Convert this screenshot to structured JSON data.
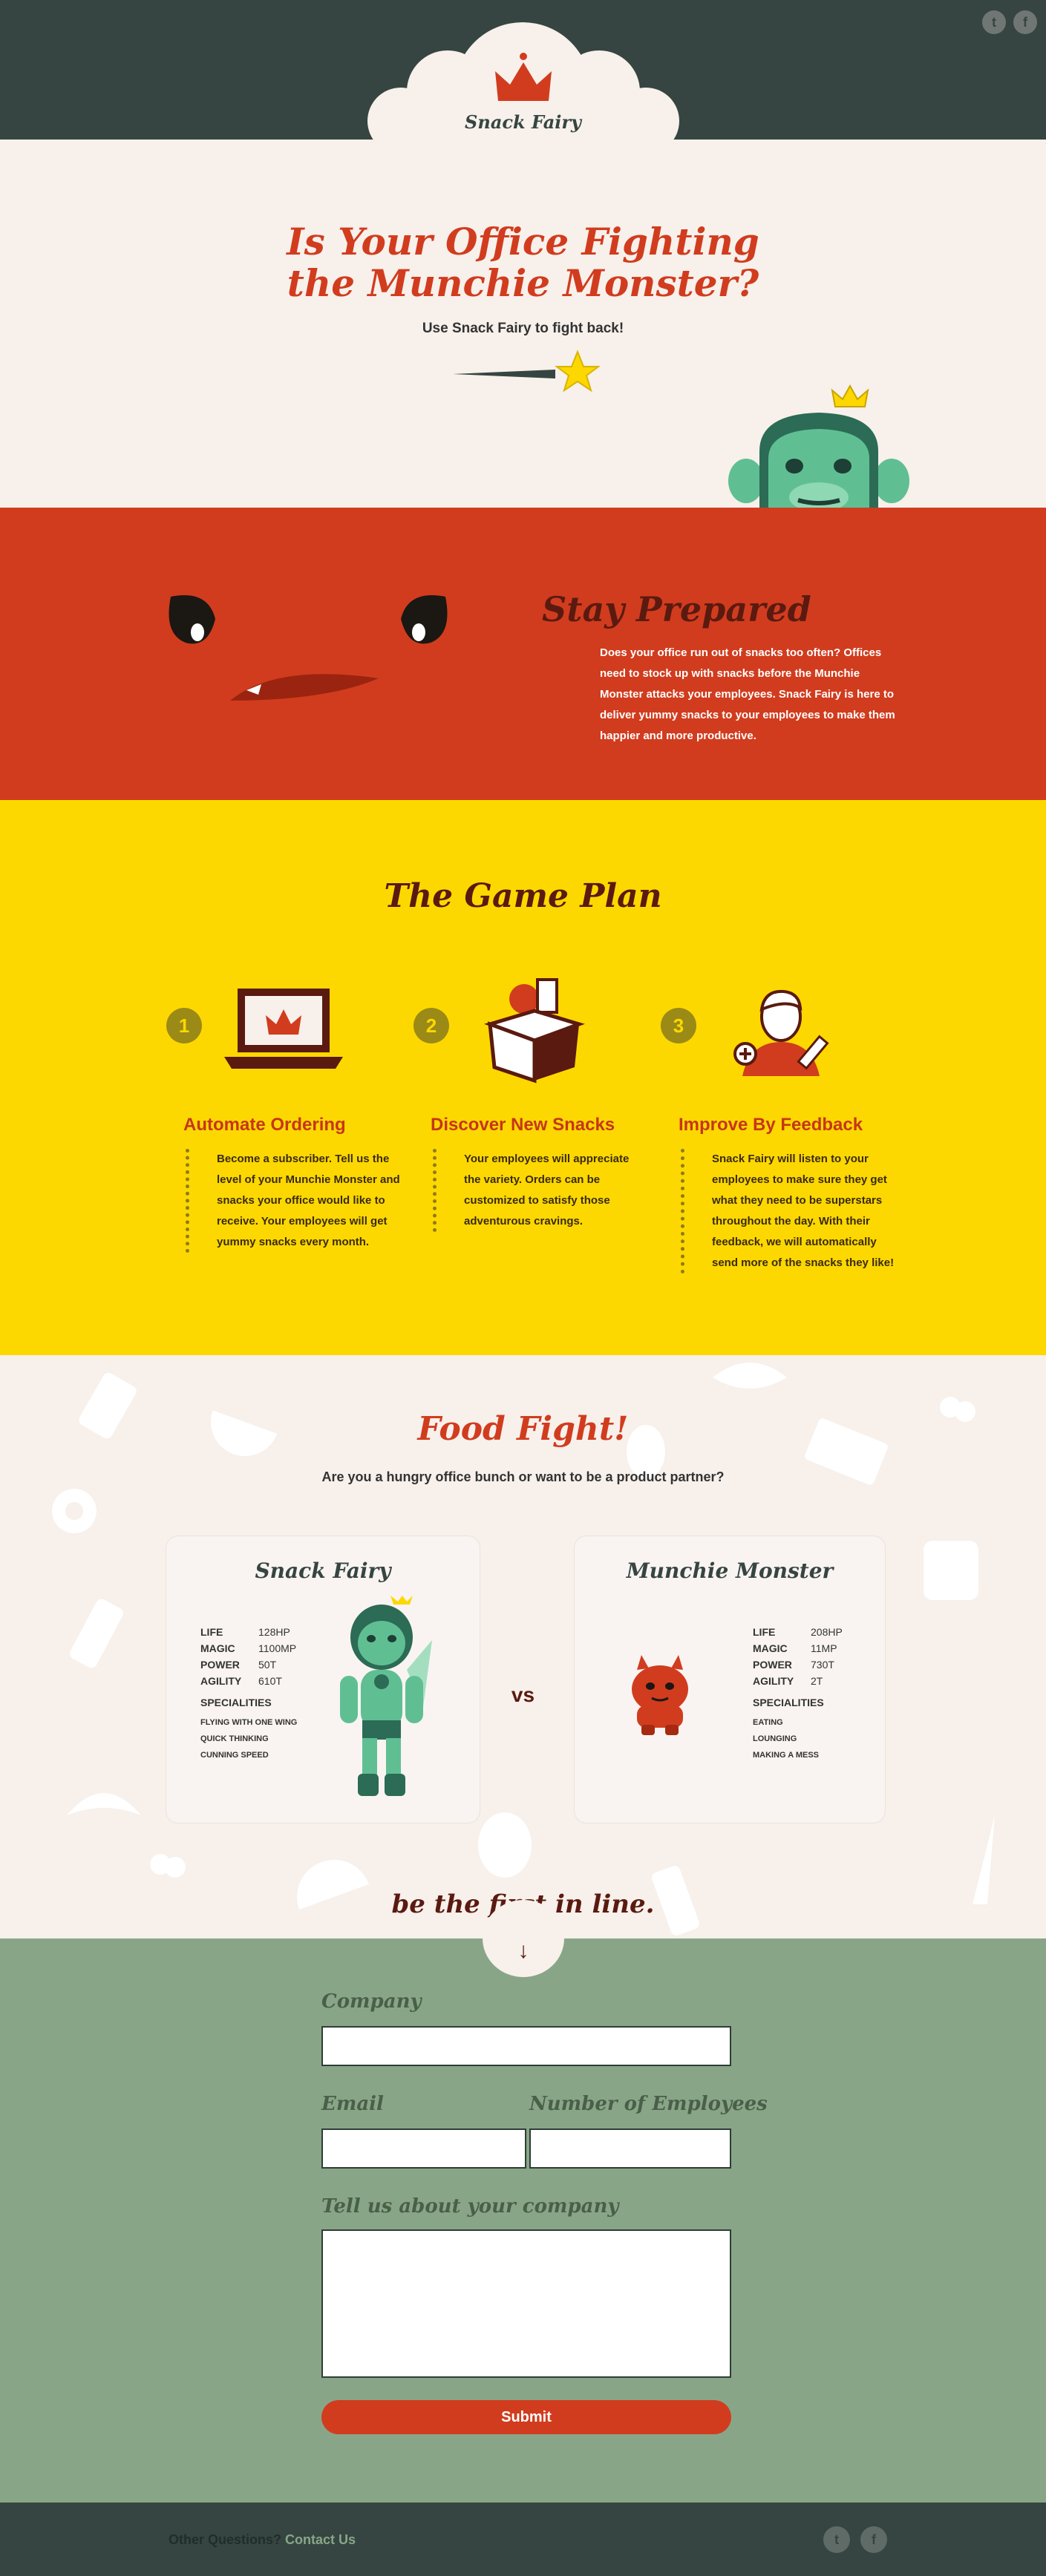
{
  "header": {
    "brand": "Snack Fairy",
    "twitter_icon": "t",
    "facebook_icon": "f"
  },
  "hero": {
    "title_line1": "Is Your Office Fighting",
    "title_line2": "the Munchie Monster?",
    "subtitle": "Use Snack Fairy to fight back!"
  },
  "prepared": {
    "title": "Stay Prepared",
    "body": "Does your office run out of snacks too often? Offices need to stock up with snacks before the Munchie Monster attacks your employees. Snack Fairy is here to deliver yummy snacks to your employees to make them happier and more productive."
  },
  "gameplan": {
    "title": "The Game Plan",
    "steps": [
      {
        "num": "1",
        "title": "Automate Ordering",
        "desc": "Become a subscriber. Tell us the level of your Munchie Monster and snacks your office would like to receive. Your employees will get yummy snacks every month."
      },
      {
        "num": "2",
        "title": "Discover New Snacks",
        "desc": "Your employees will appreciate the variety. Orders can be customized to satisfy those adventurous cravings."
      },
      {
        "num": "3",
        "title": "Improve By Feedback",
        "desc": "Snack Fairy will listen to your employees to make sure they get what they need to be superstars throughout the day. With their feedback, we will automatically send more of the snacks they like!"
      }
    ]
  },
  "fight": {
    "title": "Food Fight!",
    "subtitle": "Are you a hungry office bunch or want to be a product partner?",
    "vs": "vs",
    "fairy": {
      "name": "Snack Fairy",
      "stats": [
        [
          "LIFE",
          "128HP"
        ],
        [
          "MAGIC",
          "1100MP"
        ],
        [
          "POWER",
          "50T"
        ],
        [
          "AGILITY",
          "610T"
        ]
      ],
      "spec_title": "SPECIALITIES",
      "specs": [
        "FLYING WITH ONE WING",
        "QUICK THINKING",
        "CUNNING SPEED"
      ]
    },
    "monster": {
      "name": "Munchie Monster",
      "stats": [
        [
          "LIFE",
          "208HP"
        ],
        [
          "MAGIC",
          "11MP"
        ],
        [
          "POWER",
          "730T"
        ],
        [
          "AGILITY",
          "2T"
        ]
      ],
      "spec_title": "SPECIALITIES",
      "specs": [
        "EATING",
        "LOUNGING",
        "MAKING A MESS"
      ]
    },
    "cta": "be the first in line."
  },
  "form": {
    "company_label": "Company",
    "email_label": "Email",
    "employees_label": "Number of Employees",
    "about_label": "Tell us about your company",
    "submit_label": "Submit"
  },
  "footer": {
    "question": "Other Questions?",
    "contact": "Contact Us",
    "twitter_icon": "t",
    "facebook_icon": "f"
  },
  "colors": {
    "dark": "#364541",
    "red": "#d13c1e",
    "yellow": "#fdd800",
    "cream": "#f7f0eb",
    "green": "#88a687"
  }
}
